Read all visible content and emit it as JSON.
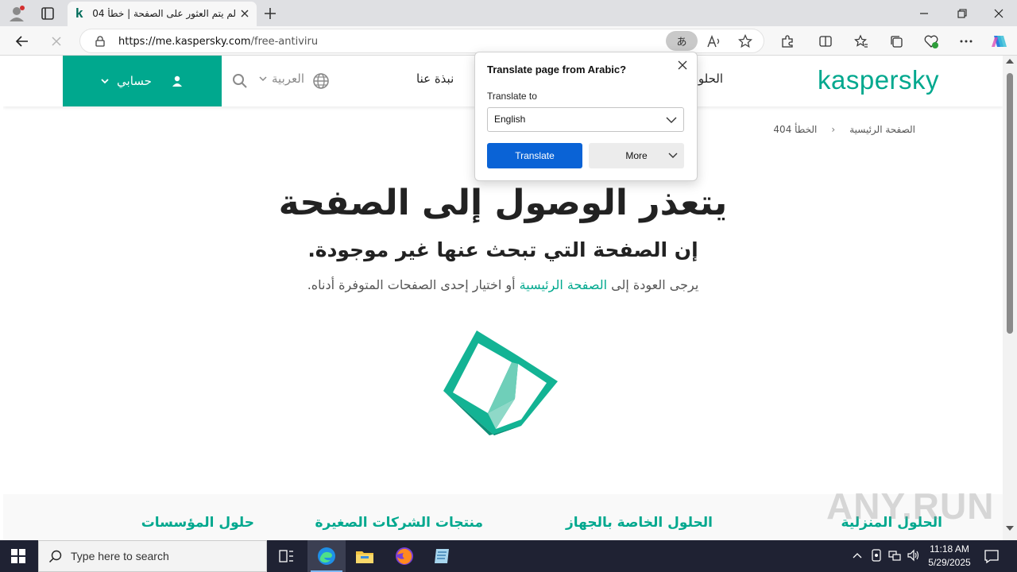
{
  "browser": {
    "tab_title": "لم يتم العثور على الصفحة | خطأ 404",
    "tab_favicon": "k",
    "url_host": "https://me.kaspersky.com",
    "url_path": "/free-antiviru",
    "translate_glyph": "あ"
  },
  "header": {
    "account_label": "حسابي",
    "language_label": "العربية",
    "nav_about": "نبذة عنا",
    "nav_solutions": "الحلول",
    "logo": "kaspersky"
  },
  "breadcrumb": {
    "home": "الصفحة الرئيسية",
    "current": "الخطأ 404"
  },
  "content": {
    "heading": "يتعذر الوصول إلى الصفحة",
    "subheading": "إن الصفحة التي تبحث عنها غير موجودة.",
    "desc_before": "يرجى العودة إلى ",
    "desc_link": "الصفحة الرئيسية",
    "desc_after": " أو اختيار إحدى الصفحات المتوفرة أدناه."
  },
  "footer_columns": [
    "الحلول المنزلية",
    "الحلول الخاصة بالجهاز",
    "منتجات الشركات الصغيرة",
    "حلول المؤسسات"
  ],
  "translate_popup": {
    "title": "Translate page from Arabic?",
    "label": "Translate to",
    "selected_language": "English",
    "translate_button": "Translate",
    "more_button": "More"
  },
  "taskbar": {
    "search_placeholder": "Type here to search",
    "time": "11:18 AM",
    "date": "5/29/2025"
  },
  "watermark": "ANY.RUN",
  "colors": {
    "brand": "#00a88e",
    "translate_button": "#0a63d6",
    "taskbar": "#1f2233"
  }
}
